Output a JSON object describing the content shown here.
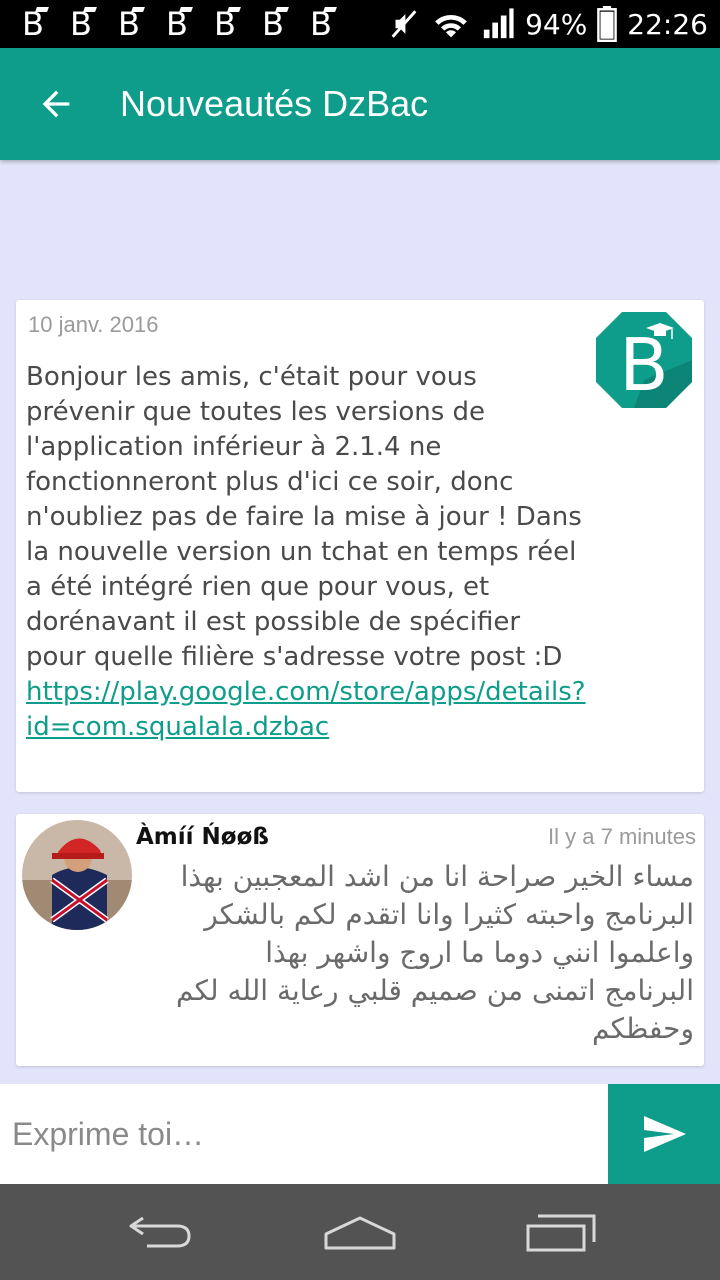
{
  "status_bar": {
    "notifications": [
      "B",
      "B",
      "B",
      "B",
      "B",
      "B",
      "B"
    ],
    "icons": [
      "mute-icon",
      "wifi-icon",
      "signal-icon"
    ],
    "battery": "94%",
    "time": "22:26"
  },
  "app_bar": {
    "title": "Nouveautés DzBac",
    "back_icon": "arrow-back-icon"
  },
  "posts": [
    {
      "date": "10 janv. 2016",
      "body": "Bonjour les amis, c'était pour vous prévenir que toutes les versions de l'application inférieur à 2.1.4 ne fonctionneront plus d'ici ce soir, donc n'oubliez pas de faire la mise à jour ! Dans la nouvelle version un tchat en temps réel a été intégré rien que pour vous, et dorénavant il est possible de spécifier pour quelle filière s'adresse votre post :D ",
      "link": "https://play.google.com/store/apps/details?id=com.squalala.dzbac",
      "avatar": "dzbac-logo"
    },
    {
      "author": "Àmíí Ńøøß",
      "time": "Il y a 7 minutes",
      "lines": [
        "مساء الخير صراحة انا من اشد المعجبين بهذا",
        "البرنامج واحبته كثيرا وانا اتقدم لكم بالشكر",
        "واعلموا انني دوما ما اروج واشهر بهذا",
        "البرنامج اتمنى من صميم قلبي رعاية الله لكم",
        "وحفظكم"
      ],
      "avatar": "user-avatar"
    }
  ],
  "input": {
    "placeholder": "Exprime toi…",
    "send_icon": "send-icon"
  },
  "nav_bar": {
    "buttons": [
      "back-icon",
      "home-icon",
      "recent-apps-icon"
    ]
  },
  "colors": {
    "primary": "#0f9d8b",
    "background": "#e3e4fb",
    "status_bar": "#000000",
    "nav_bar": "#535353"
  }
}
